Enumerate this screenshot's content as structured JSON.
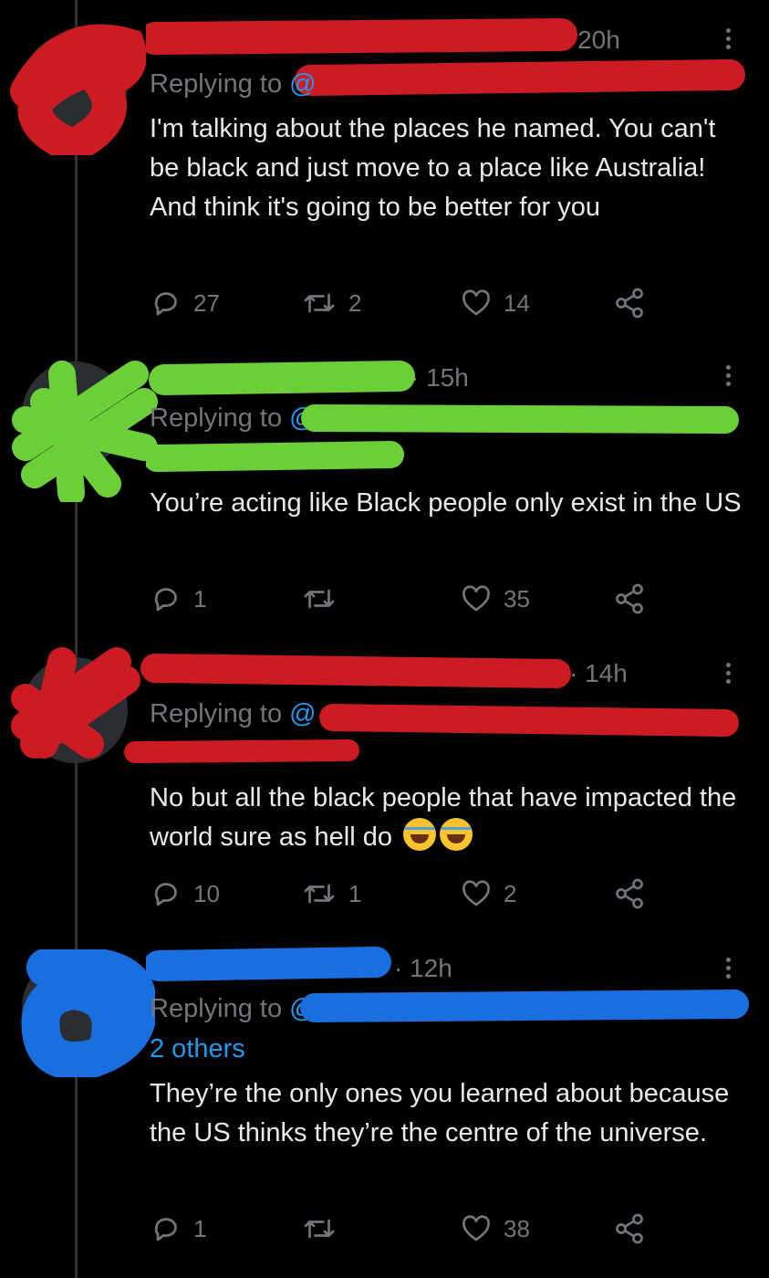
{
  "colors": {
    "background": "#000000",
    "text": "#e7e9ea",
    "muted": "#71767b",
    "link": "#1d9bf0",
    "redact_red": "#cc1b22",
    "redact_green": "#6ccf37",
    "redact_blue": "#1a6fe0"
  },
  "tweets": [
    {
      "time": "· 20h",
      "replying_prefix": "Replying to",
      "mention_fragment": "@",
      "text": "I'm talking about the places he named. You can't be black and just move to a place like Australia! And think it's going to be better for you",
      "replies": "27",
      "retweets": "2",
      "likes": "14",
      "redaction_color": "red"
    },
    {
      "time": "· 15h",
      "replying_prefix": "Replying to",
      "mention_fragment": "@",
      "text": "You’re acting like Black people only exist in the US",
      "replies": "1",
      "retweets": "",
      "likes": "35",
      "redaction_color": "green"
    },
    {
      "time": "· 14h",
      "replying_prefix": "Replying to",
      "mention_fragment": "@",
      "text": "No but all the black people that have impacted the world sure as hell do",
      "replies": "10",
      "retweets": "1",
      "likes": "2",
      "redaction_color": "red"
    },
    {
      "time": "· 12h",
      "replying_prefix": "Replying to",
      "mention_fragment": "@",
      "others": "2 others",
      "text": "They’re the only ones you learned about because the US thinks they’re the centre of the universe.",
      "replies": "1",
      "retweets": "",
      "likes": "38",
      "redaction_color": "blue"
    }
  ],
  "icons": [
    "reply-icon",
    "retweet-icon",
    "like-icon",
    "share-icon",
    "more-icon",
    "tears-of-joy-emoji"
  ]
}
